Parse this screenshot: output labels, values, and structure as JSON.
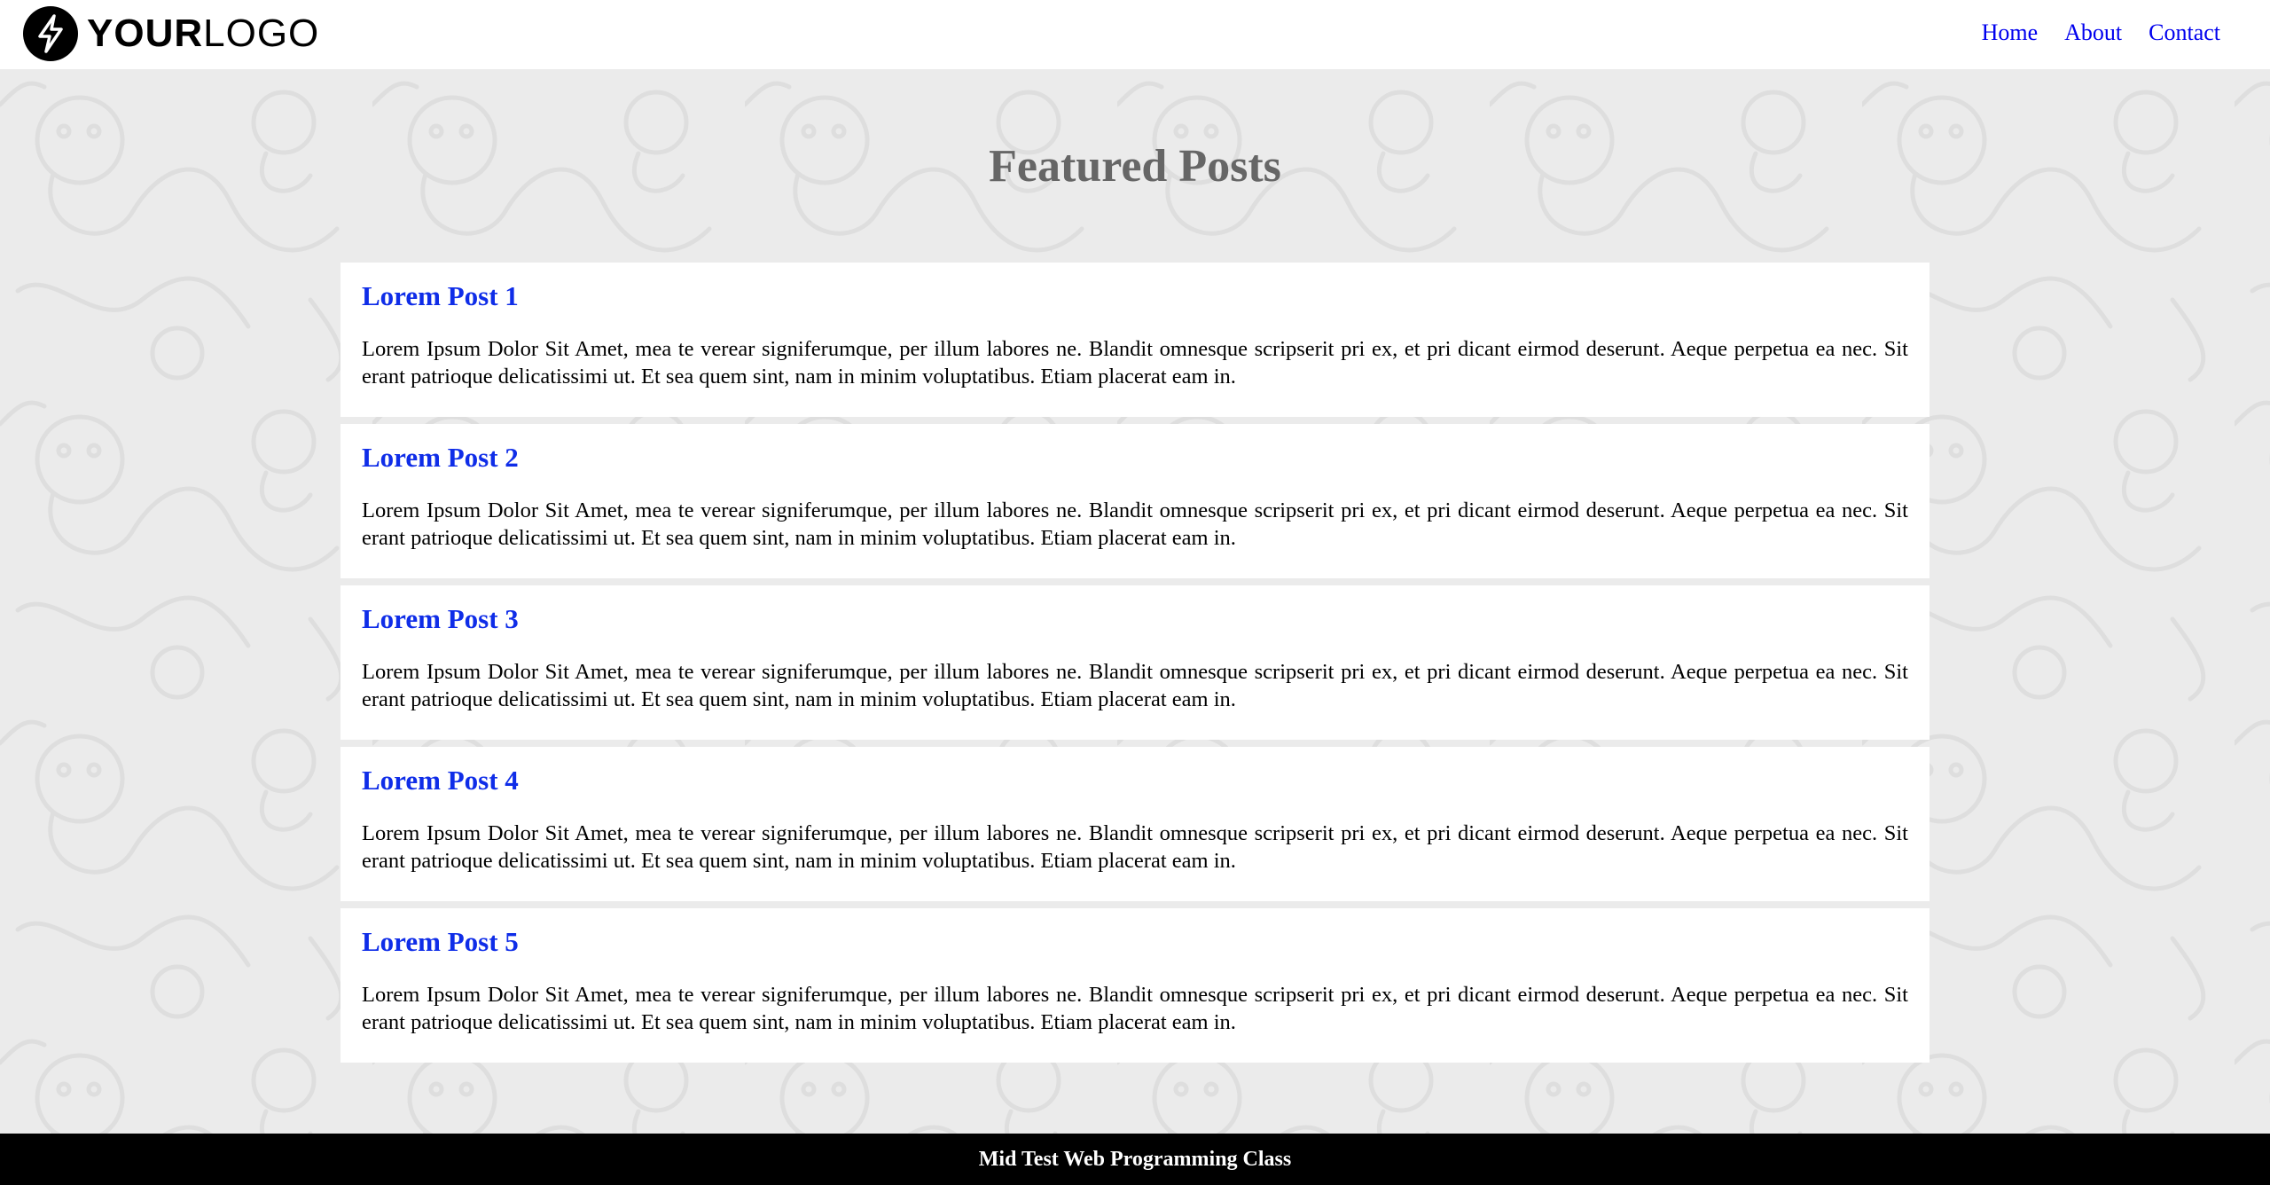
{
  "brand": {
    "logo_icon": "lightning-bolt-icon",
    "logo_bold": "YOUR",
    "logo_thin": "LOGO"
  },
  "nav": {
    "items": [
      "Home",
      "About",
      "Contact"
    ],
    "link_color": "#0000ee"
  },
  "main": {
    "title": "Featured Posts",
    "posts": [
      {
        "title": "Lorem Post 1",
        "body": "Lorem Ipsum Dolor Sit Amet, mea te verear signiferumque, per illum labores ne. Blandit omnesque scripserit pri ex, et pri dicant eirmod deserunt. Aeque perpetua ea nec. Sit erant patrioque delicatissimi ut. Et sea quem sint, nam in minim voluptatibus. Etiam placerat eam in."
      },
      {
        "title": "Lorem Post 2",
        "body": "Lorem Ipsum Dolor Sit Amet, mea te verear signiferumque, per illum labores ne. Blandit omnesque scripserit pri ex, et pri dicant eirmod deserunt. Aeque perpetua ea nec. Sit erant patrioque delicatissimi ut. Et sea quem sint, nam in minim voluptatibus. Etiam placerat eam in."
      },
      {
        "title": "Lorem Post 3",
        "body": "Lorem Ipsum Dolor Sit Amet, mea te verear signiferumque, per illum labores ne. Blandit omnesque scripserit pri ex, et pri dicant eirmod deserunt. Aeque perpetua ea nec. Sit erant patrioque delicatissimi ut. Et sea quem sint, nam in minim voluptatibus. Etiam placerat eam in."
      },
      {
        "title": "Lorem Post 4",
        "body": "Lorem Ipsum Dolor Sit Amet, mea te verear signiferumque, per illum labores ne. Blandit omnesque scripserit pri ex, et pri dicant eirmod deserunt. Aeque perpetua ea nec. Sit erant patrioque delicatissimi ut. Et sea quem sint, nam in minim voluptatibus. Etiam placerat eam in."
      },
      {
        "title": "Lorem Post 5",
        "body": "Lorem Ipsum Dolor Sit Amet, mea te verear signiferumque, per illum labores ne. Blandit omnesque scripserit pri ex, et pri dicant eirmod deserunt. Aeque perpetua ea nec. Sit erant patrioque delicatissimi ut. Et sea quem sint, nam in minim voluptatibus. Etiam placerat eam in."
      }
    ]
  },
  "footer": {
    "text": "Mid Test Web Programming Class"
  },
  "colors": {
    "page_background": "#ebebeb",
    "title_gray": "#666666",
    "post_title_blue": "#0f2de8",
    "footer_background": "#000000"
  }
}
